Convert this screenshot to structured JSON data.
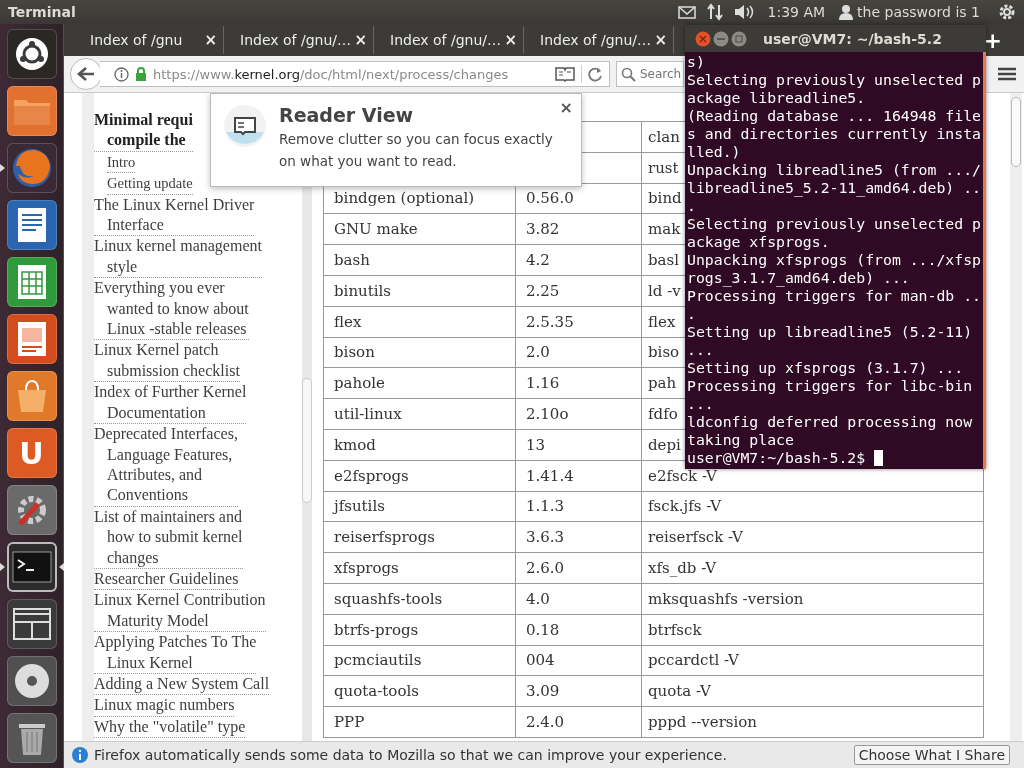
{
  "top_panel": {
    "app_title": "Terminal",
    "clock": "1:39 AM",
    "user": "the password is 1"
  },
  "launcher": [
    {
      "kind": "ubuntu",
      "running": false,
      "active": false
    },
    {
      "kind": "folder",
      "running": false,
      "active": false
    },
    {
      "kind": "firefox",
      "running": true,
      "active": false
    },
    {
      "kind": "writer",
      "running": false,
      "active": false
    },
    {
      "kind": "calc",
      "running": false,
      "active": false
    },
    {
      "kind": "impress",
      "running": false,
      "active": false
    },
    {
      "kind": "bag",
      "running": false,
      "active": false
    },
    {
      "kind": "letter",
      "glyph": "U",
      "running": false,
      "active": false
    },
    {
      "kind": "settings",
      "running": false,
      "active": false
    },
    {
      "kind": "terminal",
      "running": true,
      "active": true
    },
    {
      "kind": "workspaces",
      "running": false,
      "active": false
    },
    {
      "kind": "disc",
      "running": false,
      "active": false
    },
    {
      "kind": "trash",
      "running": false,
      "active": false
    }
  ],
  "browser": {
    "tabs": [
      {
        "title": "Index of /gnu",
        "close": "×"
      },
      {
        "title": "Index of /gnu/…",
        "close": "×"
      },
      {
        "title": "Index of /gnu/…",
        "close": "×"
      },
      {
        "title": "Index of /gnu/…",
        "close": "×"
      }
    ],
    "new_tab": "+",
    "url": {
      "prefix": "https://www.",
      "host": "kernel.org",
      "path": "/doc/html/next/process/changes"
    },
    "search": {
      "placeholder": "Search"
    },
    "sidebar": [
      {
        "lines": [
          "Minimal requi",
          "compile the"
        ],
        "current": true,
        "children": [
          {
            "lines": [
              "Intro"
            ]
          },
          {
            "lines": [
              "Getting update"
            ]
          }
        ]
      },
      {
        "lines": [
          "The Linux Kernel Driver",
          "Interface"
        ],
        "current": false
      },
      {
        "lines": [
          "Linux kernel management",
          "style"
        ],
        "current": false
      },
      {
        "lines": [
          "Everything you ever",
          "wanted to know about",
          "Linux -stable releases"
        ],
        "current": false
      },
      {
        "lines": [
          "Linux Kernel patch",
          "submission checklist"
        ],
        "current": false
      },
      {
        "lines": [
          "Index of Further Kernel",
          "Documentation"
        ],
        "current": false
      },
      {
        "lines": [
          "Deprecated Interfaces,",
          "Language Features,",
          "Attributes, and",
          "Conventions"
        ],
        "current": false
      },
      {
        "lines": [
          "List of maintainers and",
          "how to submit kernel",
          "changes"
        ],
        "current": false
      },
      {
        "lines": [
          "Researcher Guidelines"
        ],
        "current": false
      },
      {
        "lines": [
          "Linux Kernel Contribution",
          "Maturity Model"
        ],
        "current": false
      },
      {
        "lines": [
          "Applying Patches To The",
          "Linux Kernel"
        ],
        "current": false
      },
      {
        "lines": [
          "Adding a New System Call"
        ],
        "current": false
      },
      {
        "lines": [
          "Linux magic numbers"
        ],
        "current": false
      },
      {
        "lines": [
          "Why the \"volatile\" type"
        ],
        "current": false
      }
    ],
    "table": {
      "rows": [
        {
          "column_3": "clan"
        },
        {
          "column_3": "rust"
        },
        {
          "column_1": "bindgen (optional)",
          "column_2": "0.56.0",
          "column_3": "bind"
        },
        {
          "column_1": "GNU make",
          "column_2": "3.82",
          "column_3": "mak"
        },
        {
          "column_1": "bash",
          "column_2": "4.2",
          "column_3": "basl"
        },
        {
          "column_1": "binutils",
          "column_2": "2.25",
          "column_3": "ld -v"
        },
        {
          "column_1": "flex",
          "column_2": "2.5.35",
          "column_3": "flex"
        },
        {
          "column_1": "bison",
          "column_2": "2.0",
          "column_3": "biso"
        },
        {
          "column_1": "pahole",
          "column_2": "1.16",
          "column_3": "pah"
        },
        {
          "column_1": "util-linux",
          "column_2": "2.10o",
          "column_3": "fdfo"
        },
        {
          "column_1": "kmod",
          "column_2": "13",
          "column_3": "depi"
        },
        {
          "column_1": "e2fsprogs",
          "column_2": "1.41.4",
          "column_3": "e2fsck -V"
        },
        {
          "column_1": "jfsutils",
          "column_2": "1.1.3",
          "column_3": "fsck.jfs -V"
        },
        {
          "column_1": "reiserfsprogs",
          "column_2": "3.6.3",
          "column_3": "reiserfsck -V"
        },
        {
          "column_1": "xfsprogs",
          "column_2": "2.6.0",
          "column_3": "xfs_db -V"
        },
        {
          "column_1": "squashfs-tools",
          "column_2": "4.0",
          "column_3": "mksquashfs -version"
        },
        {
          "column_1": "btrfs-progs",
          "column_2": "0.18",
          "column_3": "btrfsck"
        },
        {
          "column_1": "pcmciautils",
          "column_2": "004",
          "column_3": "pccardctl -V"
        },
        {
          "column_1": "quota-tools",
          "column_2": "3.09",
          "column_3": "quota -V"
        },
        {
          "column_1": "PPP",
          "column_2": "2.4.0",
          "column_3": "pppd --version"
        }
      ]
    },
    "reader_popup": {
      "title": "Reader View",
      "text": "Remove clutter so you can focus exactly on what you want to read.",
      "close": "×"
    },
    "notification": {
      "text": "Firefox automatically sends some data to Mozilla so that we can improve your experience.",
      "button": "Choose What I Share"
    }
  },
  "terminal": {
    "title": "user@VM7: ~/bash-5.2",
    "lines": [
      "s)",
      "Selecting previously unselected p",
      "ackage libreadline5.",
      "(Reading database ... 164948 file",
      "s and directories currently insta",
      "lled.)",
      "Unpacking libreadline5 (from .../",
      "libreadline5_5.2-11_amd64.deb) ..",
      ".",
      "Selecting previously unselected p",
      "ackage xfsprogs.",
      "Unpacking xfsprogs (from .../xfsp",
      "rogs_3.1.7_amd64.deb) ...",
      "Processing triggers for man-db ..",
      ".",
      "Setting up libreadline5 (5.2-11)",
      "...",
      "Setting up xfsprogs (3.1.7) ...",
      "Processing triggers for libc-bin",
      "...",
      "ldconfig deferred processing now",
      "taking place"
    ],
    "prompt": "user@VM7:~/bash-5.2$ "
  }
}
